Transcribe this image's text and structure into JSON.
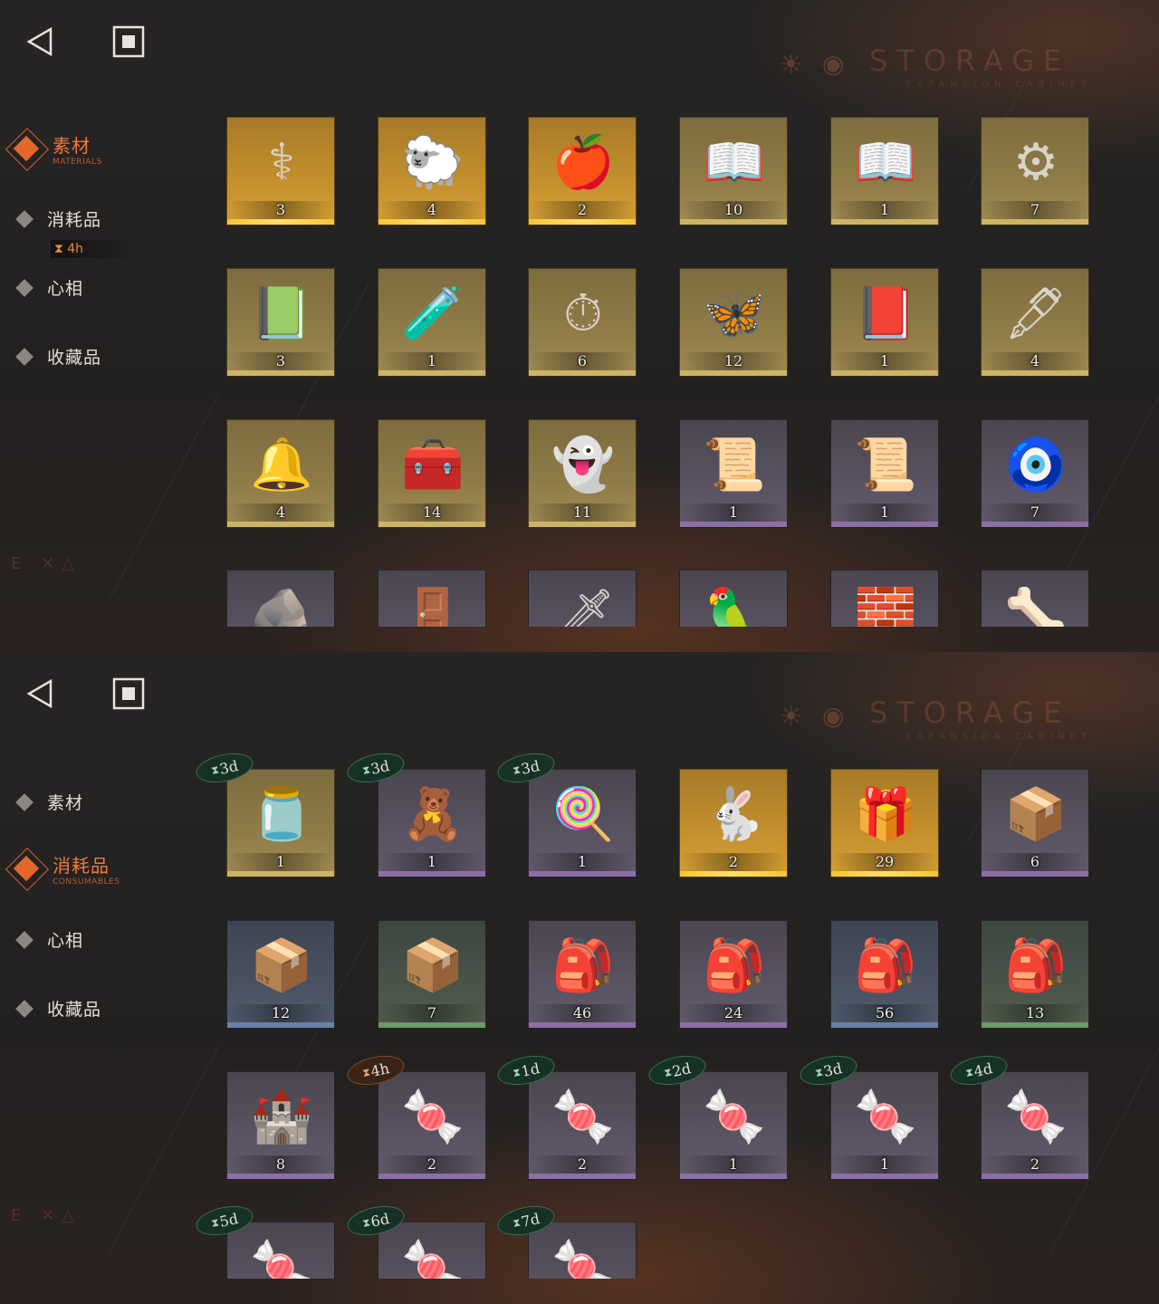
{
  "colors": {
    "accent": "#e3672d",
    "bg": "#242221"
  },
  "panel_top": {
    "watermark": {
      "title": "STORAGE",
      "subtitle": "EXPANSION CABINET"
    },
    "side_mark": "E ✕△",
    "nav": {
      "active": {
        "label": "素材",
        "sub": "MATERIALS"
      },
      "items": [
        {
          "label": "消耗品",
          "icon": "diamond-icon"
        },
        {
          "label": "心相",
          "icon": "diamond-icon"
        },
        {
          "label": "收藏品",
          "icon": "diamond-icon"
        }
      ],
      "timer": "⧗ 4h"
    },
    "items": [
      {
        "count": "3",
        "icon": "⚕",
        "rarity": "gold"
      },
      {
        "count": "4",
        "icon": "🐑",
        "rarity": "gold"
      },
      {
        "count": "2",
        "icon": "🍎",
        "rarity": "gold"
      },
      {
        "count": "10",
        "icon": "📖",
        "rarity": "goldpale"
      },
      {
        "count": "1",
        "icon": "📖",
        "rarity": "goldpale"
      },
      {
        "count": "7",
        "icon": "⚙",
        "rarity": "goldpale"
      },
      {
        "count": "3",
        "icon": "📗",
        "rarity": "goldpale"
      },
      {
        "count": "1",
        "icon": "🧪",
        "rarity": "goldpale"
      },
      {
        "count": "6",
        "icon": "⏱",
        "rarity": "goldpale"
      },
      {
        "count": "12",
        "icon": "🦋",
        "rarity": "goldpale"
      },
      {
        "count": "1",
        "icon": "📕",
        "rarity": "goldpale"
      },
      {
        "count": "4",
        "icon": "🖋",
        "rarity": "goldpale"
      },
      {
        "count": "4",
        "icon": "🔔",
        "rarity": "goldpale"
      },
      {
        "count": "14",
        "icon": "🧰",
        "rarity": "goldpale"
      },
      {
        "count": "11",
        "icon": "👻",
        "rarity": "goldpale"
      },
      {
        "count": "1",
        "icon": "📜",
        "rarity": "purple"
      },
      {
        "count": "1",
        "icon": "📜",
        "rarity": "purple"
      },
      {
        "count": "7",
        "icon": "🧿",
        "rarity": "purple"
      },
      {
        "count": "",
        "icon": "🪨",
        "rarity": "purple"
      },
      {
        "count": "",
        "icon": "🚪",
        "rarity": "purple"
      },
      {
        "count": "",
        "icon": "🗡",
        "rarity": "purple"
      },
      {
        "count": "",
        "icon": "🦜",
        "rarity": "purple"
      },
      {
        "count": "",
        "icon": "🧱",
        "rarity": "purple"
      },
      {
        "count": "",
        "icon": "🦴",
        "rarity": "purple"
      }
    ]
  },
  "panel_bottom": {
    "watermark": {
      "title": "STORAGE",
      "subtitle": "EXPANSION CABINET"
    },
    "side_mark": "E ✕△",
    "nav": {
      "items_before": [
        {
          "label": "素材",
          "icon": "diamond-icon"
        }
      ],
      "active": {
        "label": "消耗品",
        "sub": "CONSUMABLES"
      },
      "items_after": [
        {
          "label": "心相",
          "icon": "diamond-icon"
        },
        {
          "label": "收藏品",
          "icon": "diamond-icon"
        }
      ]
    },
    "items": [
      {
        "count": "1",
        "icon": "🫙",
        "rarity": "goldpale",
        "badge": "3d",
        "badge_color": "green"
      },
      {
        "count": "1",
        "icon": "🧸",
        "rarity": "purple",
        "badge": "3d",
        "badge_color": "green"
      },
      {
        "count": "1",
        "icon": "🍭",
        "rarity": "purple",
        "badge": "3d",
        "badge_color": "green"
      },
      {
        "count": "2",
        "icon": "🐇",
        "rarity": "gold",
        "badge": "",
        "badge_color": ""
      },
      {
        "count": "29",
        "icon": "🎁",
        "rarity": "gold",
        "badge": "",
        "badge_color": ""
      },
      {
        "count": "6",
        "icon": "📦",
        "rarity": "purple",
        "badge": "",
        "badge_color": ""
      },
      {
        "count": "12",
        "icon": "📦",
        "rarity": "blue",
        "badge": "",
        "badge_color": ""
      },
      {
        "count": "7",
        "icon": "📦",
        "rarity": "green",
        "badge": "",
        "badge_color": ""
      },
      {
        "count": "46",
        "icon": "🎒",
        "rarity": "purple",
        "badge": "",
        "badge_color": ""
      },
      {
        "count": "24",
        "icon": "🎒",
        "rarity": "purple",
        "badge": "",
        "badge_color": ""
      },
      {
        "count": "56",
        "icon": "🎒",
        "rarity": "blue",
        "badge": "",
        "badge_color": ""
      },
      {
        "count": "13",
        "icon": "🎒",
        "rarity": "green",
        "badge": "",
        "badge_color": ""
      },
      {
        "count": "8",
        "icon": "🏰",
        "rarity": "purple",
        "badge": "",
        "badge_color": ""
      },
      {
        "count": "2",
        "icon": "🍬",
        "rarity": "purple",
        "badge": "4h",
        "badge_color": "orange"
      },
      {
        "count": "2",
        "icon": "🍬",
        "rarity": "purple",
        "badge": "1d",
        "badge_color": "green"
      },
      {
        "count": "1",
        "icon": "🍬",
        "rarity": "purple",
        "badge": "2d",
        "badge_color": "green"
      },
      {
        "count": "1",
        "icon": "🍬",
        "rarity": "purple",
        "badge": "3d",
        "badge_color": "green"
      },
      {
        "count": "2",
        "icon": "🍬",
        "rarity": "purple",
        "badge": "4d",
        "badge_color": "green"
      },
      {
        "count": "",
        "icon": "🍬",
        "rarity": "purple",
        "badge": "5d",
        "badge_color": "green"
      },
      {
        "count": "",
        "icon": "🍬",
        "rarity": "purple",
        "badge": "6d",
        "badge_color": "green"
      },
      {
        "count": "",
        "icon": "🍬",
        "rarity": "purple",
        "badge": "7d",
        "badge_color": "green"
      }
    ]
  }
}
